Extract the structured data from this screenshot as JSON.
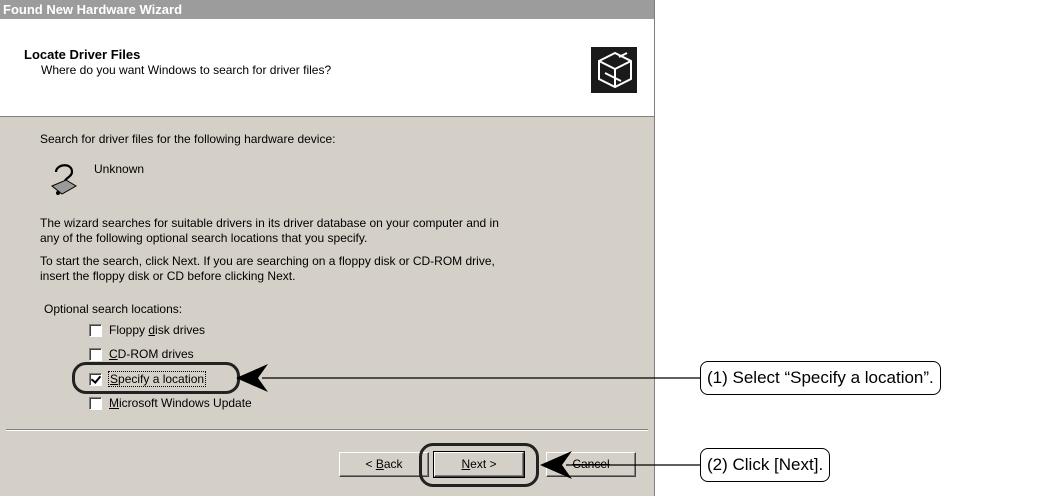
{
  "window": {
    "title": "Found New Hardware Wizard"
  },
  "header": {
    "title": "Locate Driver Files",
    "subtitle": "Where do you want Windows to search for driver files?",
    "icon": "hardware-box-icon"
  },
  "body": {
    "intro": "Search for driver files for the following hardware device:",
    "device_name": "Unknown",
    "device_icon": "unknown-device-question-icon",
    "para1_line1": "The wizard searches for suitable drivers in its driver database on your computer and in",
    "para1_line2": "any of the following optional search locations that you specify.",
    "para2_line1": "To start the search, click Next. If you are searching on a floppy disk or CD-ROM drive,",
    "para2_line2": "insert the floppy disk or CD before clicking Next.",
    "options_label": "Optional search locations:",
    "options": [
      {
        "pre": "Floppy ",
        "key": "d",
        "post": "isk drives",
        "checked": false
      },
      {
        "pre": "",
        "key": "C",
        "post": "D-ROM drives",
        "checked": false
      },
      {
        "pre": "",
        "key": "S",
        "post": "pecify a location",
        "checked": true
      },
      {
        "pre": "",
        "key": "M",
        "post": "icrosoft Windows Update",
        "checked": false
      }
    ]
  },
  "buttons": {
    "back": {
      "pre": "< ",
      "key": "B",
      "post": "ack"
    },
    "next": {
      "pre": "",
      "key": "N",
      "post": "ext >"
    },
    "cancel": "Cancel"
  },
  "annotations": {
    "callout1": "(1) Select “Specify a location”.",
    "callout2": "(2) Click [Next]."
  }
}
